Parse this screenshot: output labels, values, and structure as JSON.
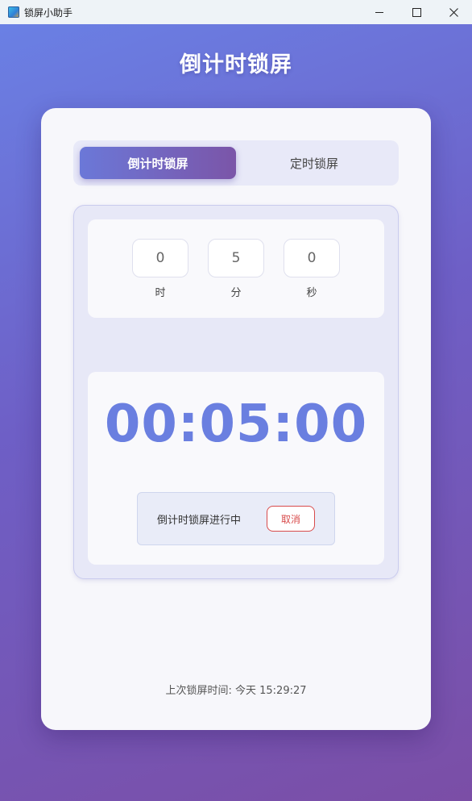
{
  "window": {
    "title": "锁屏小助手"
  },
  "header": {
    "title": "倒计时锁屏"
  },
  "tabs": [
    {
      "label": "倒计时锁屏",
      "active": true
    },
    {
      "label": "定时锁屏",
      "active": false
    }
  ],
  "inputs": {
    "hours": {
      "value": "0",
      "unit": "时"
    },
    "minutes": {
      "value": "5",
      "unit": "分"
    },
    "seconds": {
      "value": "0",
      "unit": "秒"
    }
  },
  "timer": {
    "display": "00:05:00",
    "status": "倒计时锁屏进行中",
    "cancel_label": "取消"
  },
  "footer": {
    "last_lock_label": "上次锁屏时间:",
    "last_lock_value": "今天 15:29:27"
  },
  "colors": {
    "accent": "#6a7fe0",
    "tab_gradient_start": "#6b78d8",
    "tab_gradient_end": "#7b55a8",
    "cancel": "#d84b4b"
  },
  "icons": {
    "app": "app-icon",
    "minimize": "minimize-icon",
    "maximize": "maximize-icon",
    "close": "close-icon"
  }
}
